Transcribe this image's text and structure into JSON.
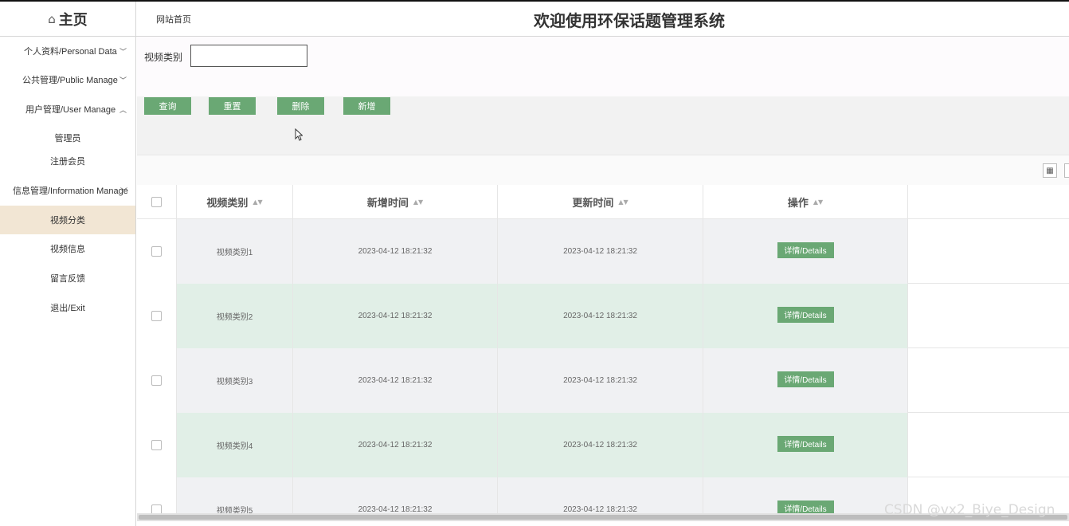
{
  "header": {
    "home_label": "主页",
    "site_link": "网站首页",
    "title": "欢迎使用环保话题管理系统"
  },
  "sidebar": {
    "groups": [
      {
        "label": "个人资料/Personal Data",
        "expanded": false
      },
      {
        "label": "公共管理/Public Manage",
        "expanded": false
      },
      {
        "label": "用户管理/User Manage",
        "expanded": true
      },
      {
        "label": "信息管理/Information Manage",
        "expanded": true
      }
    ],
    "user_items": [
      "管理员",
      "注册会员"
    ],
    "info_items": [
      "视频分类",
      "视频信息",
      "留言反馈"
    ],
    "exit": "退出/Exit",
    "active_item": "视频分类"
  },
  "search": {
    "label": "视频类别",
    "value": "",
    "placeholder": ""
  },
  "actions": {
    "query": "查询",
    "reset": "重置",
    "delete": "删除",
    "add": "新增"
  },
  "table": {
    "columns": [
      "视频类别",
      "新增时间",
      "更新时间",
      "操作"
    ],
    "rows": [
      {
        "category": "视频类别1",
        "created": "2023-04-12 18:21:32",
        "updated": "2023-04-12 18:21:32",
        "action": "详情/Details"
      },
      {
        "category": "视频类别2",
        "created": "2023-04-12 18:21:32",
        "updated": "2023-04-12 18:21:32",
        "action": "详情/Details"
      },
      {
        "category": "视频类别3",
        "created": "2023-04-12 18:21:32",
        "updated": "2023-04-12 18:21:32",
        "action": "详情/Details"
      },
      {
        "category": "视频类别4",
        "created": "2023-04-12 18:21:32",
        "updated": "2023-04-12 18:21:32",
        "action": "详情/Details"
      },
      {
        "category": "视频类别5",
        "created": "2023-04-12 18:21:32",
        "updated": "2023-04-12 18:21:32",
        "action": "详情/Details"
      }
    ]
  },
  "colors": {
    "accent_green": "#6aa874",
    "row_gray": "#f0f1f3",
    "row_green": "#e1efe7",
    "active_menu": "#f2e6d4"
  },
  "icons": {
    "home": "home-icon",
    "chevron_down": "chevron-down-icon",
    "chevron_up": "chevron-up-icon",
    "sort": "sort-icon",
    "toolbar": "column-filter-icon"
  },
  "watermark": "CSDN @vx2_Biye_Design"
}
